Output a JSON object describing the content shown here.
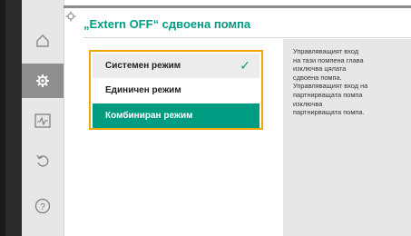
{
  "title": "„Extern OFF“ сдвоена помпа",
  "sidebar": {
    "items": [
      {
        "icon": "home-icon",
        "active": false
      },
      {
        "icon": "gear-icon",
        "active": true
      },
      {
        "icon": "diagnostics-icon",
        "active": false
      },
      {
        "icon": "back-icon",
        "active": false
      },
      {
        "icon": "help-icon",
        "active": false
      }
    ]
  },
  "options": [
    {
      "label": "Системен режим",
      "checked": true
    },
    {
      "label": "Единичен режим",
      "checked": false
    },
    {
      "label": "Комбиниран режим",
      "selected": true
    }
  ],
  "check_mark": "✓",
  "help_lines": [
    "Управляващият вход",
    "на тази помпена глава",
    "изключва цялата",
    "сдвоена помпа.",
    "Управляващият вход на",
    "партнирващата помпа",
    "изключва",
    "партнирващата помпа."
  ],
  "colors": {
    "accent": "#009c82",
    "focus": "#f0a800",
    "panel": "#e7e7e7"
  }
}
